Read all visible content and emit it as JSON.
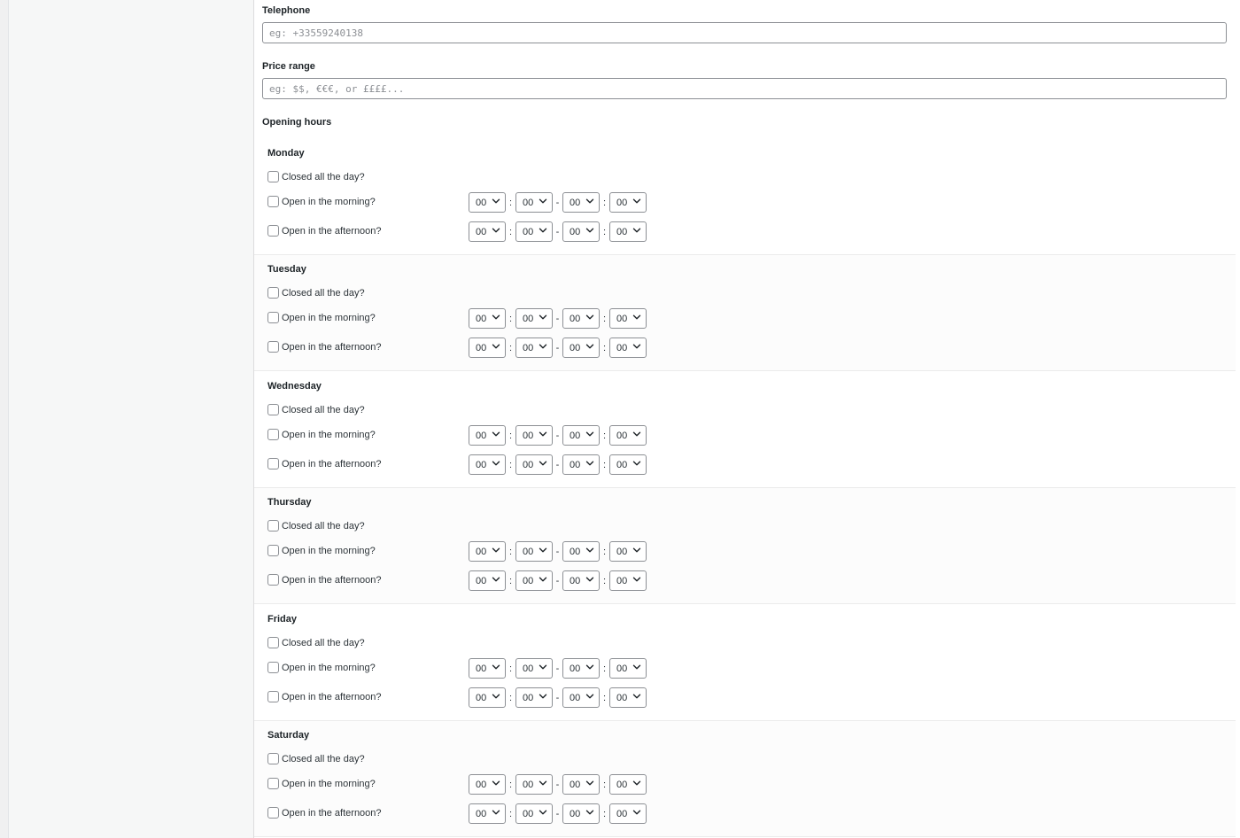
{
  "telephone": {
    "label": "Telephone",
    "placeholder": "eg: +33559240138",
    "value": ""
  },
  "price_range": {
    "label": "Price range",
    "placeholder": "eg: $$, €€€, or ££££...",
    "value": ""
  },
  "opening_hours": {
    "title": "Opening hours",
    "options": {
      "closed": "Closed all the day?",
      "morning": "Open in the morning?",
      "afternoon": "Open in the afternoon?"
    },
    "separators": {
      "colon": ":",
      "dash": "-"
    },
    "days": [
      {
        "name": "Monday",
        "morning": {
          "start_h": "00",
          "start_m": "00",
          "end_h": "00",
          "end_m": "00"
        },
        "afternoon": {
          "start_h": "00",
          "start_m": "00",
          "end_h": "00",
          "end_m": "00"
        }
      },
      {
        "name": "Tuesday",
        "morning": {
          "start_h": "00",
          "start_m": "00",
          "end_h": "00",
          "end_m": "00"
        },
        "afternoon": {
          "start_h": "00",
          "start_m": "00",
          "end_h": "00",
          "end_m": "00"
        }
      },
      {
        "name": "Wednesday",
        "morning": {
          "start_h": "00",
          "start_m": "00",
          "end_h": "00",
          "end_m": "00"
        },
        "afternoon": {
          "start_h": "00",
          "start_m": "00",
          "end_h": "00",
          "end_m": "00"
        }
      },
      {
        "name": "Thursday",
        "morning": {
          "start_h": "00",
          "start_m": "00",
          "end_h": "00",
          "end_m": "00"
        },
        "afternoon": {
          "start_h": "00",
          "start_m": "00",
          "end_h": "00",
          "end_m": "00"
        }
      },
      {
        "name": "Friday",
        "morning": {
          "start_h": "00",
          "start_m": "00",
          "end_h": "00",
          "end_m": "00"
        },
        "afternoon": {
          "start_h": "00",
          "start_m": "00",
          "end_h": "00",
          "end_m": "00"
        }
      },
      {
        "name": "Saturday",
        "morning": {
          "start_h": "00",
          "start_m": "00",
          "end_h": "00",
          "end_m": "00"
        },
        "afternoon": {
          "start_h": "00",
          "start_m": "00",
          "end_h": "00",
          "end_m": "00"
        }
      }
    ]
  },
  "icons": {
    "dropdown": "chevron-down-icon",
    "checkbox": "checkbox-unchecked-icon"
  }
}
